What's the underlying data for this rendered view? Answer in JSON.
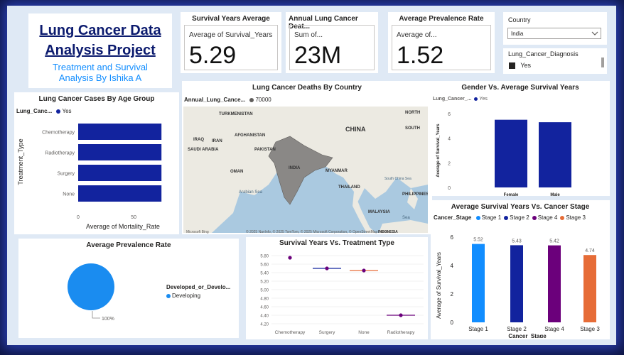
{
  "header": {
    "title_line1": "Lung Cancer Data ",
    "title_line2": "Analysis Project",
    "subtitle_line1": "Treatment and Survival",
    "subtitle_line2": "Analysis By Ishika A"
  },
  "kpis": [
    {
      "title": "Survival Years Average",
      "label": "Average of Survival_Years",
      "value": "5.29"
    },
    {
      "title": "Annual Lung Cancer Deat...",
      "label": "Sum of...",
      "value": "23M"
    },
    {
      "title": "Average Prevalence Rate",
      "label": "Average of...",
      "value": "1.52"
    }
  ],
  "filters": {
    "country_label": "Country",
    "country_value": "India",
    "diagnosis_label": "Lung_Cancer_Diagnosis",
    "diagnosis_value": "Yes"
  },
  "colors": {
    "navy": "#12239e",
    "blue": "#118dff",
    "purple": "#6b007b",
    "orange": "#e66c37",
    "pie": "#1a8cf0"
  },
  "age_chart": {
    "title": "Lung Cancer Cases By Age Group",
    "legend_field": "Lung_Canc...",
    "legend_value": "Yes",
    "ylabel": "Treatment_Type",
    "xlabel": "Average of Mortality_Rate",
    "x_ticks": [
      "0",
      "50"
    ]
  },
  "map": {
    "title": "Lung Cancer Deaths By Country",
    "legend_field": "Annual_Lung_Cance...",
    "legend_value": "70000",
    "labels": [
      {
        "text": "TURKMENISTAN",
        "name": "map-label-turkmenistan"
      },
      {
        "text": "AFGHANISTAN",
        "name": "map-label-afghanistan"
      },
      {
        "text": "IRAQ",
        "name": "map-label-iraq"
      },
      {
        "text": "IRAN",
        "name": "map-label-iran"
      },
      {
        "text": "PAKISTAN",
        "name": "map-label-pakistan"
      },
      {
        "text": "SAUDI ARABIA",
        "name": "map-label-saudi-arabia"
      },
      {
        "text": "OMAN",
        "name": "map-label-oman"
      },
      {
        "text": "INDIA",
        "name": "map-label-india"
      },
      {
        "text": "CHINA",
        "name": "map-label-china"
      },
      {
        "text": "MYANMAR",
        "name": "map-label-myanmar"
      },
      {
        "text": "THAILAND",
        "name": "map-label-thailand"
      },
      {
        "text": "South China Sea",
        "name": "map-label-south-china-sea"
      },
      {
        "text": "PHILIPPINES",
        "name": "map-label-philippines"
      },
      {
        "text": "MALAYSIA",
        "name": "map-label-malaysia"
      },
      {
        "text": "Arabian Sea",
        "name": "map-label-arabian-sea"
      },
      {
        "text": "NORTH",
        "name": "map-label-north"
      },
      {
        "text": "SOUTH",
        "name": "map-label-south"
      },
      {
        "text": "Sea",
        "name": "map-label-sea"
      },
      {
        "text": "INDONESIA",
        "name": "map-label-indonesia"
      }
    ],
    "bing_label": "Microsoft Bing",
    "copyright": "© 2025 NavInfo, © 2025 TomTom, © 2025 Microsoft Corporation, © OpenStreetMap Terms"
  },
  "gender_chart": {
    "title": "Gender Vs. Average Survival Years",
    "legend_field": "Lung_Cancer_...",
    "legend_value": "Yes",
    "ylabel": "Average of Survival_Years",
    "y_ticks": [
      "6",
      "4",
      "2",
      "0"
    ]
  },
  "stage_chart": {
    "title": "Average Survival Years Vs. Cancer Stage",
    "legend_field": "Cancer_Stage",
    "ylabel": "Average of Survival_Years",
    "xlabel": "Cancer_Stage",
    "y_ticks": [
      "6",
      "4",
      "2",
      "0"
    ]
  },
  "prevalence_chart": {
    "title": "Average Prevalence Rate",
    "legend_field": "Developed_or_Develo...",
    "legend_value": "Developing",
    "slice_label": "100%"
  },
  "treatment_chart": {
    "title": "Survival Years Vs. Treatment Type",
    "y_ticks": [
      "5.80",
      "5.60",
      "5.40",
      "5.20",
      "5.00",
      "4.80",
      "4.60",
      "4.40",
      "4.20"
    ]
  },
  "chart_data": [
    {
      "type": "bar",
      "orientation": "horizontal",
      "title": "Lung Cancer Cases By Age Group",
      "categories": [
        "Chemotherapy",
        "Radiotherapy",
        "Surgery",
        "None"
      ],
      "values": [
        75,
        75,
        75,
        75
      ],
      "xlabel": "Average of Mortality_Rate",
      "ylabel": "Treatment_Type",
      "xlim": [
        0,
        80
      ],
      "legend": "top-left"
    },
    {
      "type": "bar",
      "title": "Gender Vs. Average Survival Years",
      "categories": [
        "Female",
        "Male"
      ],
      "values": [
        5.5,
        5.3
      ],
      "ylabel": "Average of Survival_Years",
      "ylim": [
        0,
        6
      ],
      "legend": "top-left"
    },
    {
      "type": "bar",
      "title": "Average Survival Years Vs. Cancer Stage",
      "categories": [
        "Stage 1",
        "Stage 2",
        "Stage 4",
        "Stage 3"
      ],
      "values": [
        5.52,
        5.43,
        5.42,
        4.74
      ],
      "xlabel": "Cancer_Stage",
      "ylabel": "Average of Survival_Years",
      "ylim": [
        0,
        6
      ],
      "legend": "top-left"
    },
    {
      "type": "pie",
      "title": "Average Prevalence Rate",
      "categories": [
        "Developing"
      ],
      "values": [
        100
      ],
      "legend": "right"
    },
    {
      "type": "scatter",
      "title": "Survival Years Vs. Treatment Type",
      "categories": [
        "Chemotherapy",
        "Surgery",
        "None",
        "Radiotherapy"
      ],
      "values": [
        5.75,
        5.5,
        5.45,
        4.4
      ],
      "ylim": [
        4.2,
        5.8
      ],
      "grid": true
    }
  ]
}
